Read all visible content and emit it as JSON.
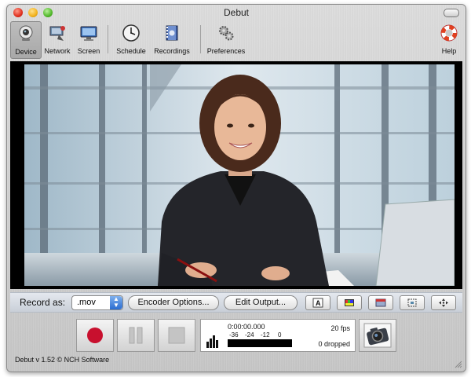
{
  "window": {
    "title": "Debut"
  },
  "toolbar": {
    "device": "Device",
    "network": "Network",
    "screen": "Screen",
    "schedule": "Schedule",
    "recordings": "Recordings",
    "preferences": "Preferences",
    "help": "Help"
  },
  "record": {
    "label": "Record as:",
    "format": ".mov",
    "encoder_options": "Encoder Options...",
    "edit_output": "Edit Output..."
  },
  "status": {
    "time": "0:00:00.000",
    "scale": [
      "-36",
      "-24",
      "-12",
      "0"
    ],
    "fps": "20 fps",
    "dropped": "0 dropped"
  },
  "footer": {
    "version": "Debut v 1.52 © NCH Software"
  },
  "colors": {
    "record": "#c8102e",
    "accent": "#2a6cd0"
  }
}
